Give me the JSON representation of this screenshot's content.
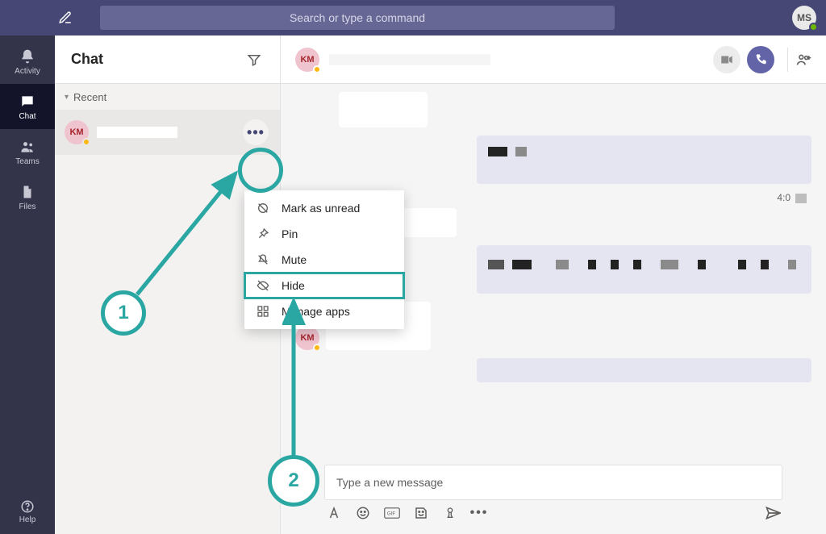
{
  "titlebar": {
    "search_placeholder": "Search or type a command",
    "user_initials": "MS"
  },
  "leftrail": {
    "items": [
      {
        "id": "activity",
        "label": "Activity"
      },
      {
        "id": "chat",
        "label": "Chat"
      },
      {
        "id": "teams",
        "label": "Teams"
      },
      {
        "id": "files",
        "label": "Files"
      }
    ],
    "active_id": "chat",
    "help_label": "Help"
  },
  "chatlist": {
    "title": "Chat",
    "section_label": "Recent",
    "entry": {
      "initials": "KM"
    }
  },
  "context_menu": {
    "items": [
      {
        "id": "unread",
        "label": "Mark as unread"
      },
      {
        "id": "pin",
        "label": "Pin"
      },
      {
        "id": "mute",
        "label": "Mute"
      },
      {
        "id": "hide",
        "label": "Hide"
      },
      {
        "id": "apps",
        "label": "Manage apps"
      }
    ],
    "highlighted_id": "hide"
  },
  "conversation": {
    "header_initials": "KM",
    "timestamp": "4:0",
    "sender_initials": "KM",
    "compose_placeholder": "Type a new message"
  },
  "annotations": {
    "step1": "1",
    "step2": "2"
  },
  "colors": {
    "accent_teal": "#2aa7a2",
    "brand_purple": "#464775"
  }
}
